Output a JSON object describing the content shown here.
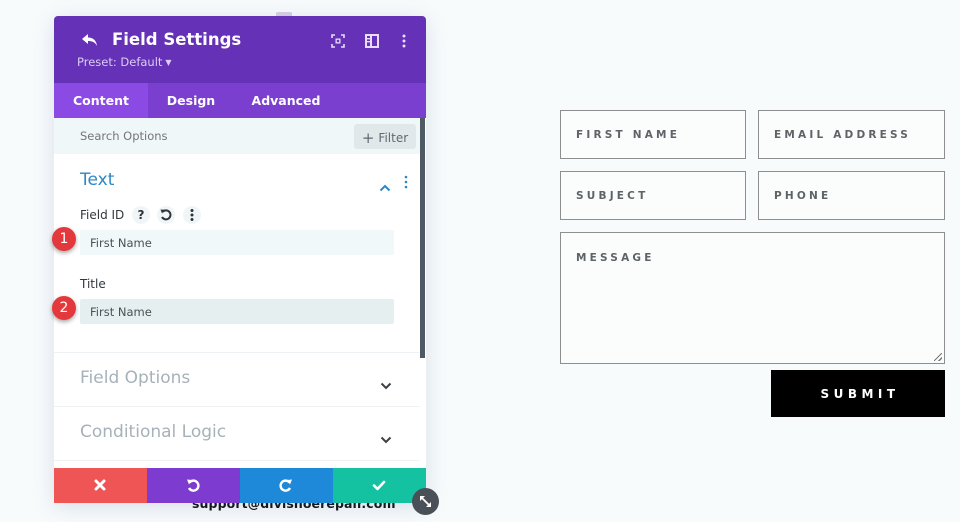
{
  "background": {
    "footer_email": "support@divishoerepair.com"
  },
  "contact_form": {
    "fields": {
      "first_name": "FIRST NAME",
      "email": "EMAIL ADDRESS",
      "subject": "SUBJECT",
      "phone": "PHONE",
      "message": "MESSAGE"
    },
    "submit_label": "SUBMIT"
  },
  "modal": {
    "title": "Field Settings",
    "preset": "Preset: Default",
    "icons": {
      "back": "undo-arrow-icon",
      "focus": "focus-mode-icon",
      "split": "split-view-icon",
      "more": "more-vertical-icon"
    },
    "tabs": [
      {
        "label": "Content",
        "active": true
      },
      {
        "label": "Design",
        "active": false
      },
      {
        "label": "Advanced",
        "active": false
      }
    ],
    "search": {
      "placeholder": "Search Options",
      "filter_label": "Filter"
    },
    "sections": {
      "text": {
        "title": "Text",
        "expanded": true,
        "fields": {
          "field_id": {
            "label": "Field ID",
            "value": "First Name",
            "badge": "1"
          },
          "title": {
            "label": "Title",
            "value": "First Name",
            "badge": "2"
          }
        },
        "field_id_icons": {
          "help": "?",
          "reset": "reset-icon",
          "more": "more-icon"
        }
      },
      "field_options": {
        "title": "Field Options",
        "expanded": false
      },
      "conditional_logic": {
        "title": "Conditional Logic",
        "expanded": false
      }
    },
    "footer": {
      "cancel": "close-icon",
      "undo": "undo-icon",
      "redo": "redo-icon",
      "save": "check-icon"
    },
    "colors": {
      "header": "#6531b6",
      "tabs": "#7b3fd0",
      "active_tab": "#8c4ae4",
      "section_title": "#2b87c6",
      "cancel": "#ef5555",
      "undo": "#7e3bd0",
      "redo": "#1f89d9",
      "save": "#14c1a1",
      "badge": "#e3383c"
    }
  }
}
